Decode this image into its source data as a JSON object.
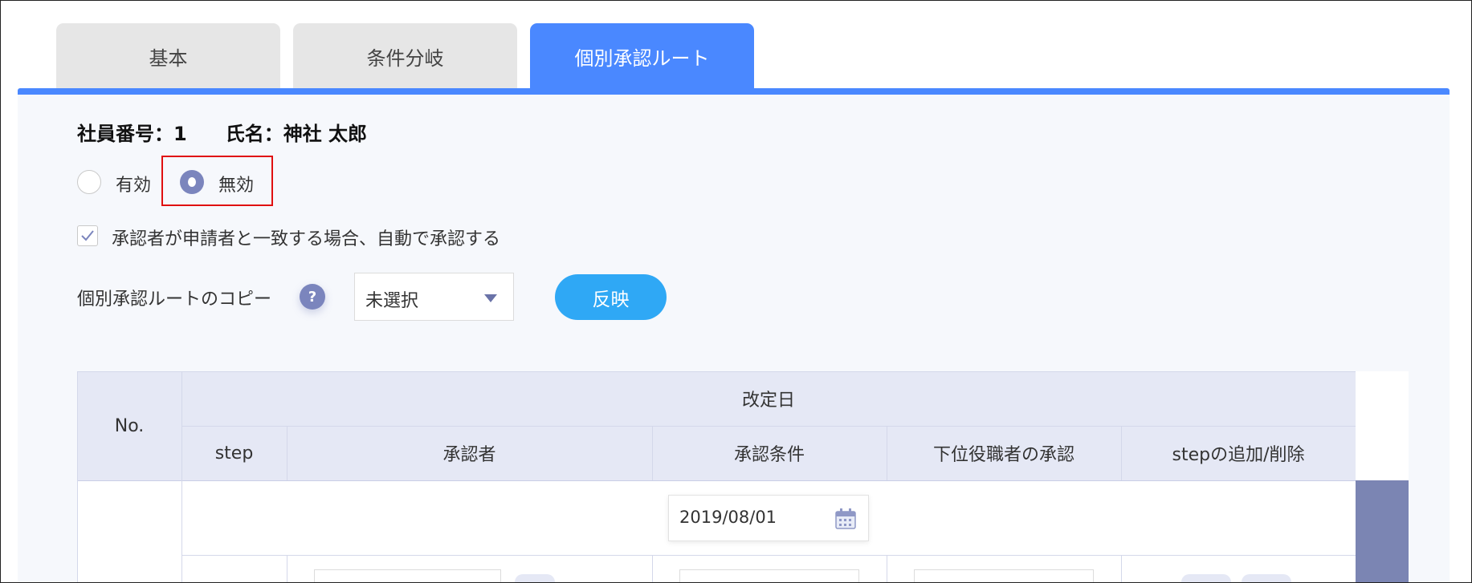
{
  "tabs": [
    {
      "label": "基本",
      "active": false
    },
    {
      "label": "条件分岐",
      "active": false
    },
    {
      "label": "個別承認ルート",
      "active": true
    }
  ],
  "employee": {
    "info": "社員番号：1　　氏名：神社 太郎"
  },
  "status_radio": {
    "options": [
      {
        "label": "有効",
        "selected": false
      },
      {
        "label": "無効",
        "selected": true
      }
    ]
  },
  "auto_approve": {
    "checked": true,
    "label": "承認者が申請者と一致する場合、自動で承認する"
  },
  "copy_route": {
    "label": "個別承認ルートのコピー",
    "help_glyph": "?",
    "select_value": "未選択",
    "apply_label": "反映"
  },
  "table": {
    "headers": {
      "no": "No.",
      "revision_date": "改定日",
      "step": "step",
      "approver": "承認者",
      "condition": "承認条件",
      "subordinate_approval": "下位役職者の承認",
      "add_remove": "stepの追加/削除"
    },
    "row": {
      "date": "2019/08/01"
    }
  },
  "colors": {
    "accent": "#4a88ff",
    "header_bg": "#e5e8f5",
    "radio_selected": "#7b85bd",
    "apply_button": "#2fa8f5",
    "highlight": "#e01010"
  },
  "icons": [
    "calendar-icon",
    "check-icon",
    "chevron-down-icon",
    "help-icon"
  ]
}
